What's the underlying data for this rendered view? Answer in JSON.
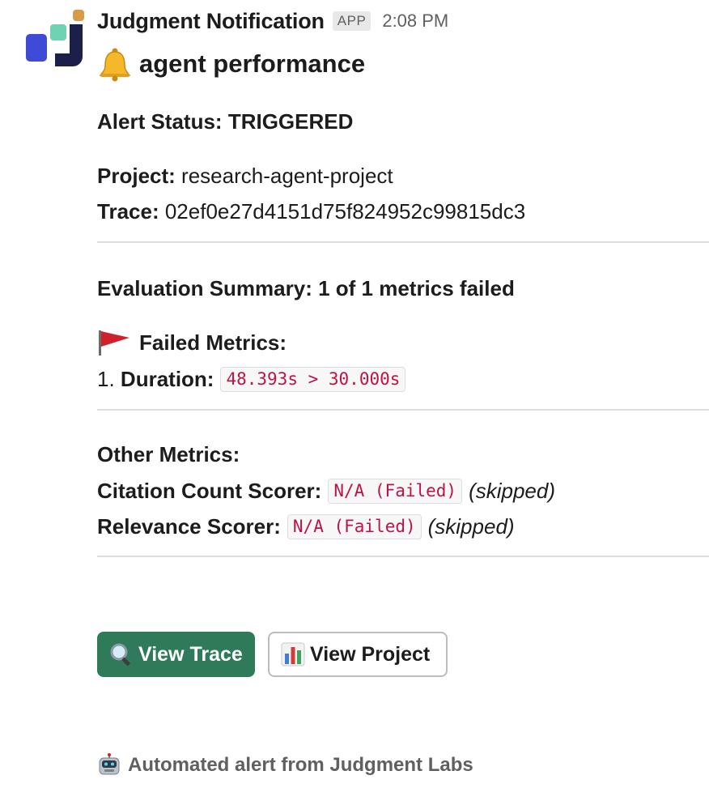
{
  "message": {
    "sender": "Judgment Notification",
    "app_badge": "APP",
    "timestamp": "2:08 PM",
    "title": "agent performance",
    "title_icon": "bell-icon"
  },
  "alert": {
    "status_label": "Alert Status:",
    "status_value": "TRIGGERED",
    "project_label": "Project:",
    "project_value": "research-agent-project",
    "trace_label": "Trace:",
    "trace_value": "02ef0e27d4151d75f824952c99815dc3"
  },
  "summary": {
    "text": "Evaluation Summary: 1 of 1 metrics failed"
  },
  "failed_metrics": {
    "heading": "Failed Metrics:",
    "heading_icon": "red-flag-icon",
    "items": [
      {
        "number": "1.",
        "name": "Duration:",
        "value": "48.393s > 30.000s"
      }
    ]
  },
  "other_metrics": {
    "heading": "Other Metrics:",
    "items": [
      {
        "name": "Citation Count Scorer:",
        "value": "N/A (Failed)",
        "note": "(skipped)"
      },
      {
        "name": "Relevance Scorer:",
        "value": "N/A (Failed)",
        "note": "(skipped)"
      }
    ]
  },
  "actions": {
    "view_trace_label": "View Trace",
    "view_trace_icon": "magnifier-icon",
    "view_project_label": "View Project",
    "view_project_icon": "bar-chart-icon"
  },
  "footer": {
    "text": "Automated alert from Judgment Labs",
    "icon": "robot-icon"
  },
  "colors": {
    "primary_button": "#2f7a58",
    "code_text": "#c01343",
    "muted_text": "#616061"
  }
}
